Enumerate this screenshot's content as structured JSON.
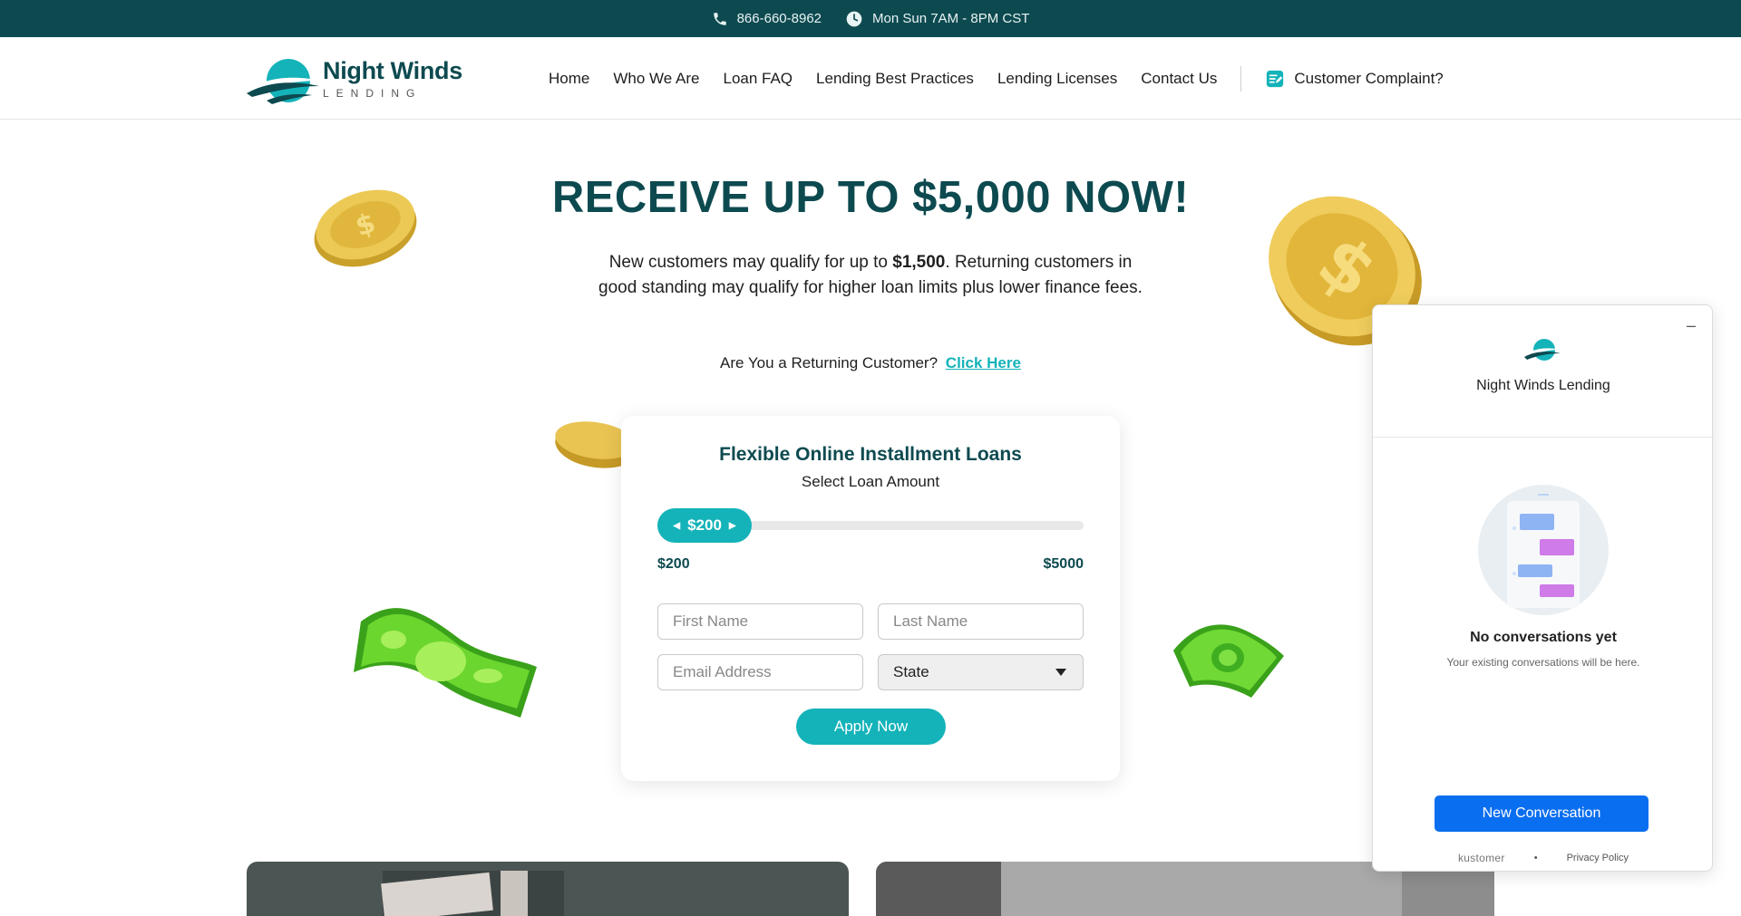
{
  "topbar": {
    "phone": "866-660-8962",
    "hours": "Mon Sun 7AM - 8PM CST"
  },
  "header": {
    "logo_name": "Night Winds",
    "logo_sub": "LENDING",
    "nav": {
      "home": "Home",
      "who": "Who We Are",
      "faq": "Loan FAQ",
      "practices": "Lending Best Practices",
      "licenses": "Lending Licenses",
      "contact": "Contact Us",
      "complaint": "Customer Complaint?"
    }
  },
  "hero": {
    "title": "RECEIVE UP TO $5,000 NOW!",
    "text_before": "New customers may qualify for up to ",
    "text_bold": "$1,500",
    "text_after": ". Returning customers in good standing may qualify for higher loan limits plus lower finance fees.",
    "returning_prompt": "Are You a Returning Customer?",
    "returning_link": "Click Here"
  },
  "form": {
    "title": "Flexible Online Installment Loans",
    "subtitle": "Select Loan Amount",
    "slider_value": "$200",
    "slider_fraction": 0,
    "min": "$200",
    "max": "$5000",
    "first_name_placeholder": "First Name",
    "last_name_placeholder": "Last Name",
    "email_placeholder": "Email Address",
    "state_value": "State",
    "apply": "Apply Now"
  },
  "chat": {
    "brand": "Night Winds Lending",
    "minimize": "–",
    "empty_title": "No conversations yet",
    "empty_sub": "Your existing conversations will be here.",
    "new_conversation": "New Conversation",
    "powered": "kustomer",
    "privacy": "Privacy Policy"
  },
  "colors": {
    "brand_dark": "#0d4a50",
    "teal": "#14b3b9",
    "chat_blue": "#0a6ef0"
  }
}
